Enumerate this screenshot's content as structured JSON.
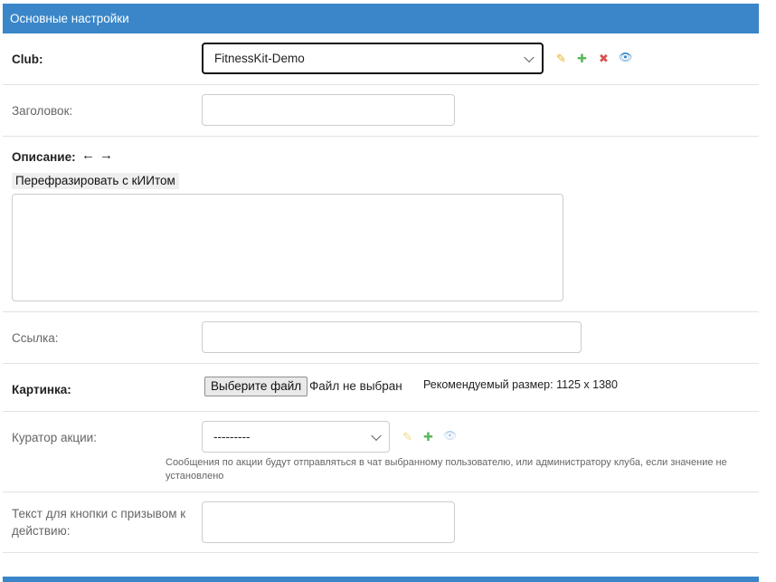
{
  "header": {
    "title": "Основные настройки"
  },
  "club": {
    "label": "Club:",
    "selected": "FitnessKit-Demo",
    "icons": {
      "edit": "pencil-icon",
      "add": "plus-icon",
      "delete": "cross-icon",
      "view": "eye-icon"
    },
    "icon_glyphs": {
      "edit": "✎",
      "add": "✚",
      "delete": "✖",
      "view": "👁"
    }
  },
  "title_field": {
    "label": "Заголовок:",
    "value": ""
  },
  "description": {
    "label": "Описание:",
    "undo_glyph": "←",
    "redo_glyph": "→",
    "rephrase_label": "Перефразировать с кИИтом",
    "value": ""
  },
  "link": {
    "label": "Ссылка:",
    "value": ""
  },
  "image": {
    "label": "Картинка:",
    "choose_label": "Выберите файл",
    "no_file": "Файл не выбран",
    "recommended": "Рекомендуемый размер: 1125 x 1380"
  },
  "curator": {
    "label": "Куратор акции:",
    "selected": "---------",
    "icon_glyphs": {
      "edit": "✎",
      "add": "✚",
      "view": "👁"
    },
    "help": "Сообщения по акции будут отправляться в чат выбранному пользователю, или администратору клуба, если значение не установлено"
  },
  "cta": {
    "label": "Текст для кнопки с призывом к действию:",
    "value": ""
  },
  "colors": {
    "accent": "#3a86c8",
    "edit_icon": "#e6b325",
    "add_icon": "#5cb85c",
    "delete_icon": "#d9534f",
    "view_icon": "#3a86c8"
  }
}
